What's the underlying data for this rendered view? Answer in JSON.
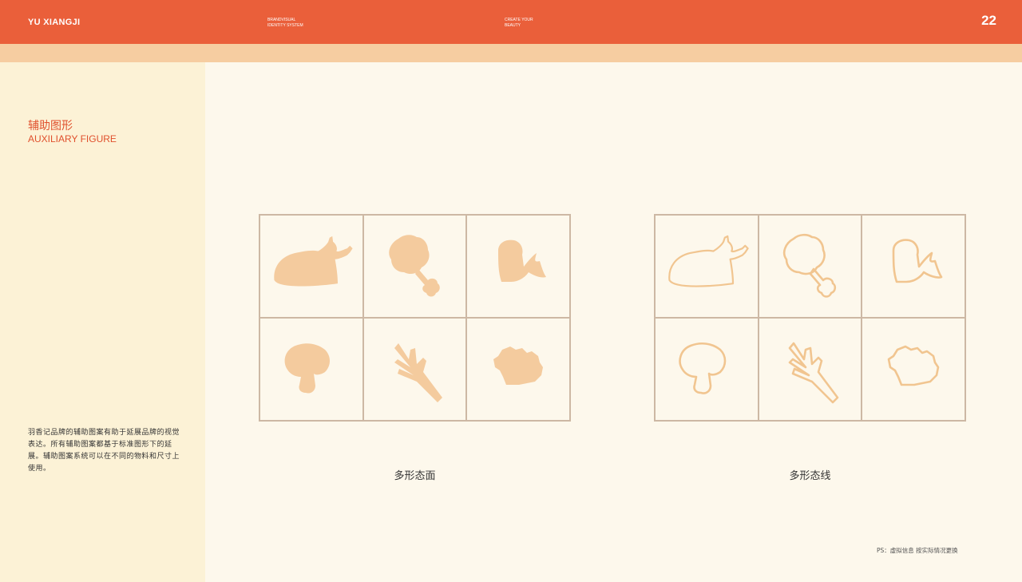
{
  "header": {
    "brand": "YU XIANGJI",
    "tagline_1": "BRANDVISUAL\nIDENTITY SYSTEM",
    "tagline_2": "CREATE  YOUR\nBEAUTY",
    "page_number": "22"
  },
  "sidebar": {
    "title_cn": "辅助图形",
    "title_en": "AUXILIARY FIGURE",
    "description": "羽香记品牌的辅助图案有助于延展品牌的视觉表达。所有辅助图案都基于标准图形下的延展。辅助图案系统可以在不同的物料和尺寸上使用。"
  },
  "panels": [
    {
      "label": "多形态面",
      "style": "filled",
      "icons": [
        "roast-chicken-icon",
        "drumstick-icon",
        "chicken-wing-icon",
        "mushroom-icon",
        "scallion-icon",
        "broccoli-icon"
      ]
    },
    {
      "label": "多形态线",
      "style": "outline",
      "icons": [
        "roast-chicken-icon",
        "drumstick-icon",
        "chicken-wing-icon",
        "mushroom-icon",
        "scallion-icon",
        "broccoli-icon"
      ]
    }
  ],
  "footnote": "PS：虚拟信息 按实际情况更换",
  "colors": {
    "accent": "#ea5f3a",
    "peach": "#f6cda1",
    "icon": "#f4cb9e",
    "sidebar": "#fcf2d6",
    "background": "#fdf8ec"
  }
}
